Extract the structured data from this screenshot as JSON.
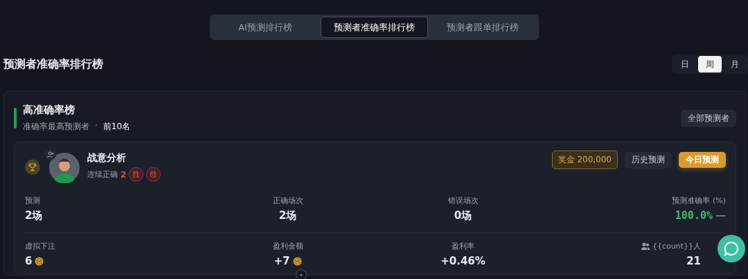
{
  "tabs": [
    {
      "label": "AI预测排行榜",
      "selected": false
    },
    {
      "label": "预测者准确率排行榜",
      "selected": true
    },
    {
      "label": "预测者跟单排行榜",
      "selected": false
    }
  ],
  "page_title": "预测者准确率排行榜",
  "periods": [
    {
      "label": "日",
      "selected": false
    },
    {
      "label": "周",
      "selected": true
    },
    {
      "label": "月",
      "selected": false
    }
  ],
  "board": {
    "title": "高准确率榜",
    "subtitle": "准确率最高预测者",
    "separator": "·",
    "limit": "前10名",
    "all_button": "全部预测者",
    "entry": {
      "name": "战意分析",
      "streak_label": "连续正确",
      "streak_count": "2",
      "results": [
        {
          "label": "胜"
        },
        {
          "label": "胜"
        }
      ],
      "prize": "奖金 200,000",
      "history_button": "历史预测",
      "today_button": "今日预测",
      "stats": [
        {
          "kind": "plain",
          "label": "预测",
          "value": "2场"
        },
        {
          "kind": "plain",
          "label": "正确场次",
          "value": "2场"
        },
        {
          "kind": "plain",
          "label": "错误场次",
          "value": "0场"
        },
        {
          "kind": "rate",
          "label": "预测准确率 (%)",
          "value": "100.0%",
          "trend": "—"
        },
        {
          "kind": "coin",
          "label": "虚拟下注",
          "value": "6"
        },
        {
          "kind": "coin",
          "label": "盈利金额",
          "value": "+7"
        },
        {
          "kind": "plain",
          "label": "盈利率",
          "value": "+0.46%"
        },
        {
          "kind": "people",
          "label": "{{count}}人",
          "value": "21"
        }
      ]
    }
  }
}
